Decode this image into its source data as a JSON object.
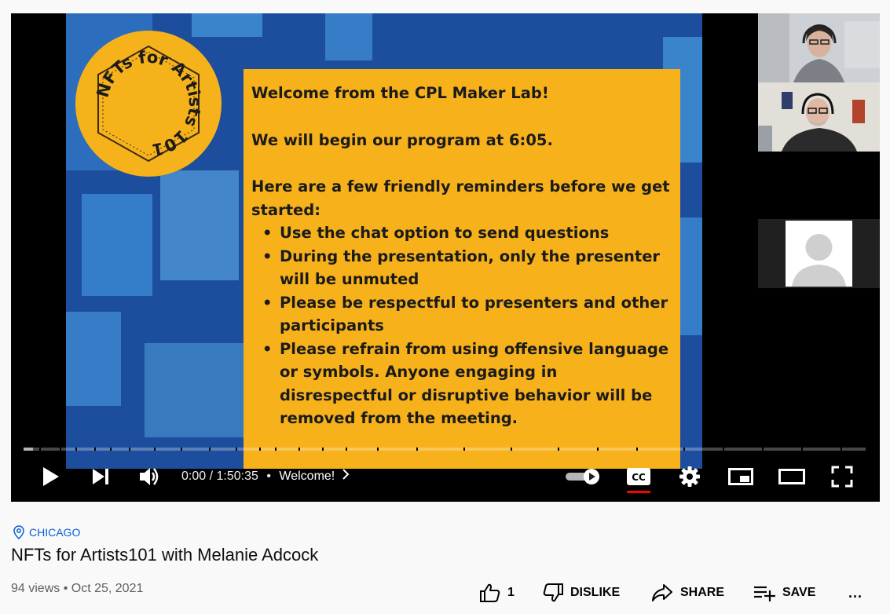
{
  "slide": {
    "badge_text": "NFTs for Artists 101",
    "lines": [
      "Welcome from the CPL Maker Lab!",
      "We will begin our program at 6:05.",
      "Here are a few friendly reminders before we get started:"
    ],
    "bullets": [
      "Use the chat option to send questions",
      "During the presentation, only the presenter will be unmuted",
      "Please be respectful to presenters and other participants",
      "Please refrain from using offensive language or symbols. Anyone engaging in disrespectful or disruptive behavior will be removed from the meeting."
    ]
  },
  "player": {
    "current_time": "0:00",
    "duration": "1:50:35",
    "time_separator": "/",
    "chapter": "Welcome!",
    "cc_label": "CC",
    "progress": 0,
    "icons": [
      "play-icon",
      "next-icon",
      "volume-icon",
      "autoplay-toggle-icon",
      "cc-icon",
      "settings-gear-icon",
      "miniplayer-icon",
      "theater-icon",
      "fullscreen-icon"
    ]
  },
  "video": {
    "location": "CHICAGO",
    "title": "NFTs for Artists101 with Melanie Adcock",
    "views": "94 views",
    "date": "Oct 25, 2021",
    "like_count": "1",
    "dislike_label": "DISLIKE",
    "share_label": "SHARE",
    "save_label": "SAVE",
    "more_label": "..."
  },
  "colors": {
    "accent": "#ff0000",
    "link": "#065fd4",
    "slide_yellow": "#f7b11a",
    "slide_blue": "#1d4e9e"
  }
}
